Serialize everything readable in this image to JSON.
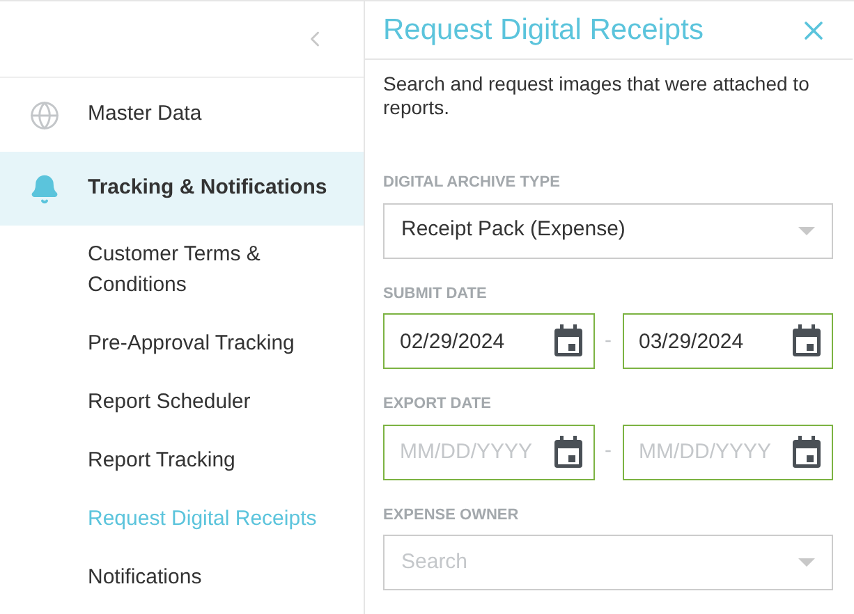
{
  "sidebar": {
    "items": [
      {
        "kind": "section",
        "label": "Master Data",
        "selected": false
      },
      {
        "kind": "section",
        "label": "Tracking & Notifications",
        "selected": true
      },
      {
        "kind": "link",
        "label": "Customer Terms & Conditions",
        "selected": false
      },
      {
        "kind": "link",
        "label": "Pre-Approval Tracking",
        "selected": false
      },
      {
        "kind": "link",
        "label": "Report Scheduler",
        "selected": false
      },
      {
        "kind": "link",
        "label": "Report Tracking",
        "selected": false
      },
      {
        "kind": "link",
        "label": "Request Digital Receipts",
        "selected": true
      },
      {
        "kind": "link",
        "label": "Notifications",
        "selected": false
      }
    ]
  },
  "panel": {
    "title": "Request Digital Receipts",
    "description": "Search and request images that were attached to reports.",
    "fields": [
      {
        "kind": "select",
        "label": "DIGITAL ARCHIVE TYPE",
        "value": "Receipt Pack (Expense)"
      },
      {
        "kind": "date_range",
        "label": "SUBMIT DATE",
        "separator": "-",
        "from": {
          "value": "02/29/2024"
        },
        "to": {
          "value": "03/29/2024"
        }
      },
      {
        "kind": "date_range",
        "label": "EXPORT DATE",
        "separator": "-",
        "from": {
          "placeholder": "MM/DD/YYYY"
        },
        "to": {
          "placeholder": "MM/DD/YYYY"
        }
      },
      {
        "kind": "select",
        "label": "EXPENSE OWNER",
        "placeholder": "Search"
      }
    ]
  }
}
